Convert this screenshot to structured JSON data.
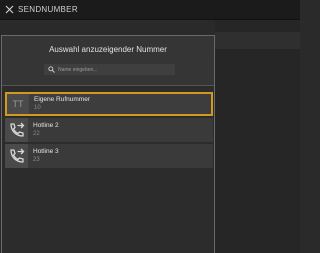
{
  "window": {
    "title": "SENDNUMBER"
  },
  "dialog": {
    "title": "Auswahl anzuzeigender Nummer",
    "search": {
      "placeholder": "Name eingeben...",
      "value": ""
    },
    "items": [
      {
        "icon_text": "TT",
        "icon": "initials-avatar",
        "name": "Eigene Rufnummer",
        "number": "10",
        "selected": true
      },
      {
        "icon": "phone-forward-icon",
        "name": "Hotline 2",
        "number": "22",
        "selected": false
      },
      {
        "icon": "phone-forward-icon",
        "name": "Hotline 3",
        "number": "23",
        "selected": false
      }
    ]
  },
  "colors": {
    "accent": "#d19a1f",
    "background": "#2a2a2a",
    "titlebar": "#1b1b1b"
  }
}
